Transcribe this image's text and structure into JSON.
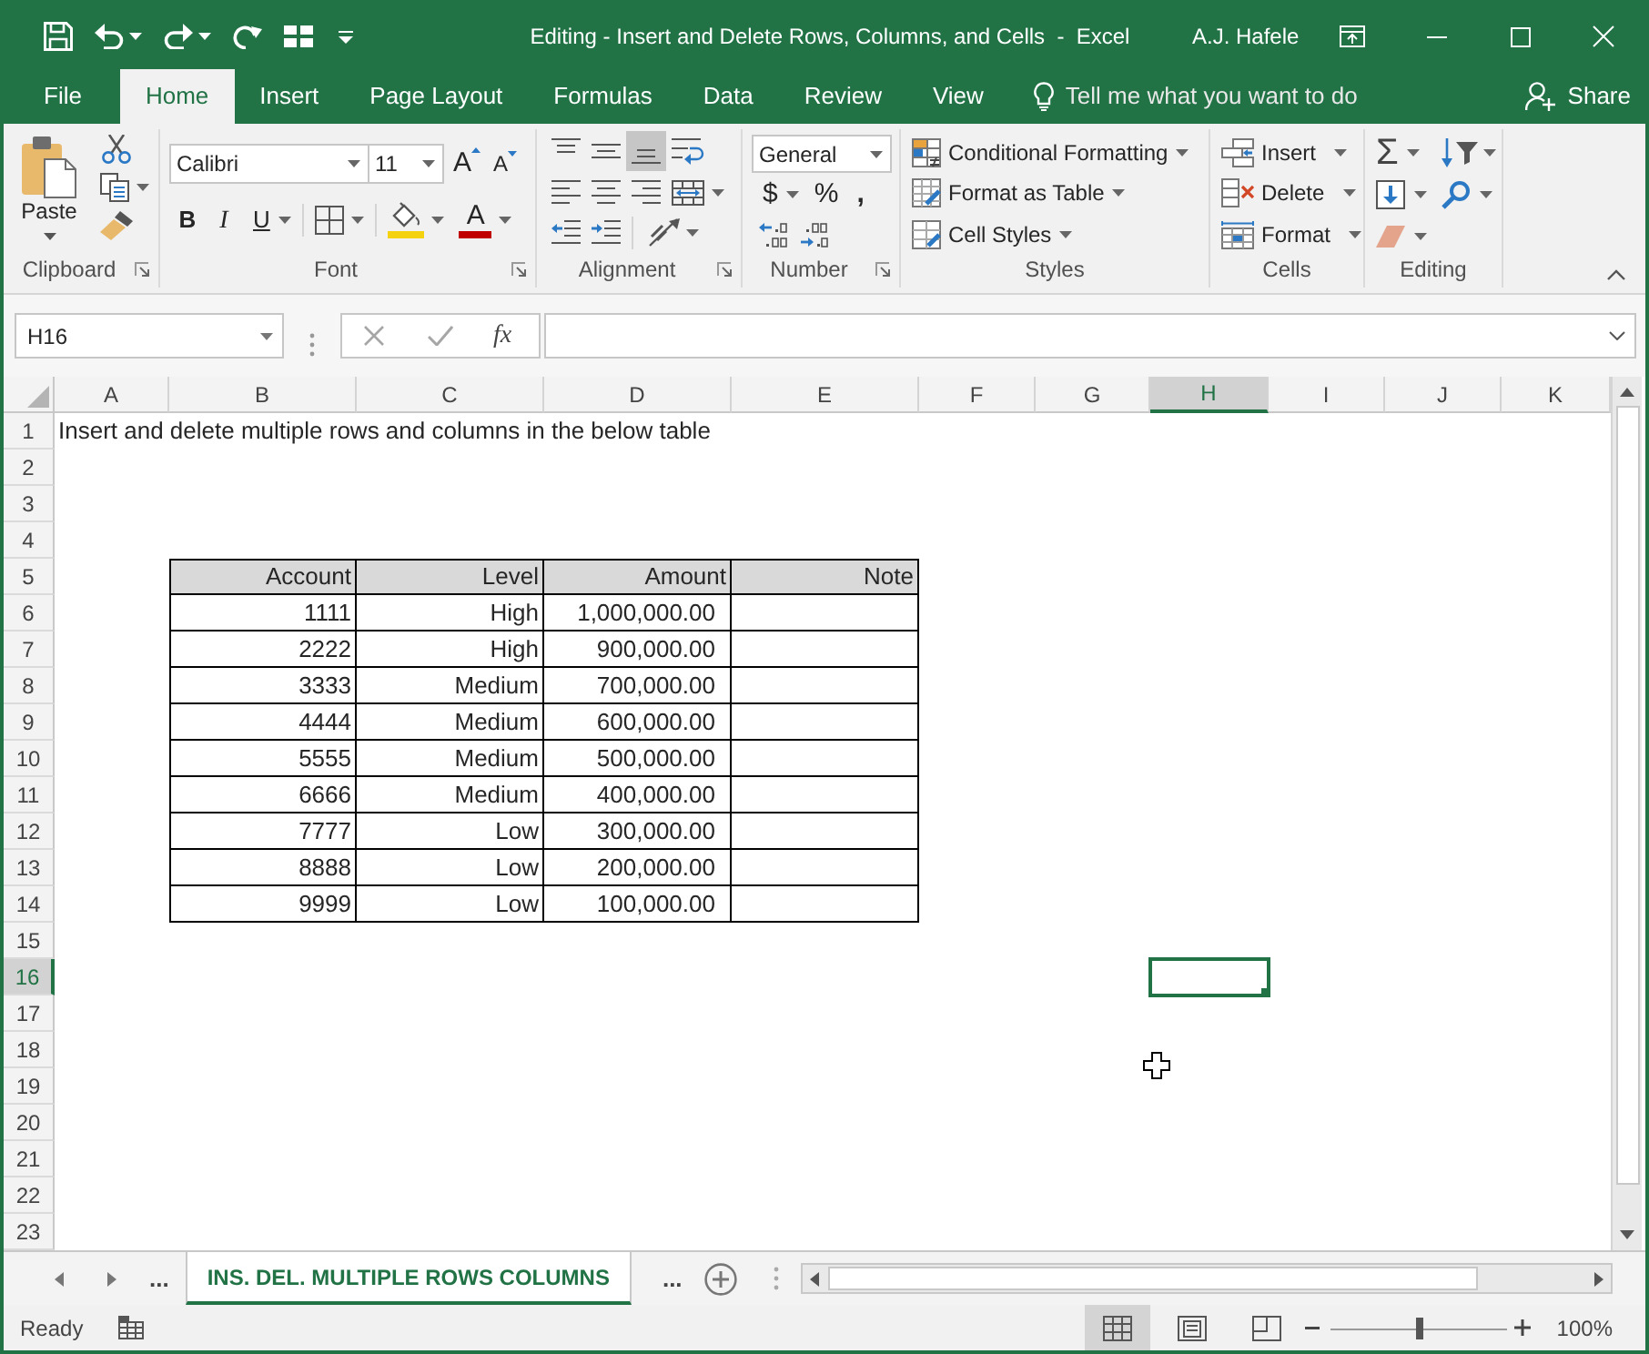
{
  "window": {
    "title": "Editing - Insert and Delete Rows, Columns, and Cells  -  Excel",
    "user": "A.J. Hafele"
  },
  "ribbon_tabs": [
    {
      "label": "File",
      "selected": false
    },
    {
      "label": "Home",
      "selected": true
    },
    {
      "label": "Insert",
      "selected": false
    },
    {
      "label": "Page Layout",
      "selected": false
    },
    {
      "label": "Formulas",
      "selected": false
    },
    {
      "label": "Data",
      "selected": false
    },
    {
      "label": "Review",
      "selected": false
    },
    {
      "label": "View",
      "selected": false
    }
  ],
  "tell_me": {
    "placeholder": "Tell me what you want to do"
  },
  "share": {
    "label": "Share"
  },
  "ribbon": {
    "clipboard": {
      "paste": "Paste",
      "label": "Clipboard"
    },
    "font": {
      "font_name": "Calibri",
      "font_size": "11",
      "grow_font": "A",
      "shrink_font": "A",
      "bold": "B",
      "italic": "I",
      "underline": "U",
      "font_color": "A",
      "label": "Font"
    },
    "alignment": {
      "vertical": [
        {
          "kind": "top",
          "selected": false
        },
        {
          "kind": "middle",
          "selected": false
        },
        {
          "kind": "bottom",
          "selected": true
        }
      ],
      "label": "Alignment"
    },
    "number": {
      "format": "General",
      "currency": "$",
      "percent": "%",
      "comma": ",",
      "label": "Number"
    },
    "styles": {
      "items": [
        {
          "kind": "conditional_formatting",
          "label": "Conditional Formatting"
        },
        {
          "kind": "format_as_table",
          "label": "Format as Table"
        },
        {
          "kind": "cell_styles",
          "label": "Cell Styles"
        }
      ],
      "label": "Styles"
    },
    "cells": {
      "items": [
        {
          "kind": "insert",
          "label": "Insert"
        },
        {
          "kind": "delete",
          "label": "Delete"
        },
        {
          "kind": "format",
          "label": "Format"
        }
      ],
      "label": "Cells"
    },
    "editing": {
      "autosum": "Σ",
      "label": "Editing"
    }
  },
  "formula_bar": {
    "name_box": "H16",
    "function_label": "fx"
  },
  "sheet": {
    "columns": [
      {
        "label": "A",
        "selected": false
      },
      {
        "label": "B",
        "selected": false
      },
      {
        "label": "C",
        "selected": false
      },
      {
        "label": "D",
        "selected": false
      },
      {
        "label": "E",
        "selected": false
      },
      {
        "label": "F",
        "selected": false
      },
      {
        "label": "G",
        "selected": false
      },
      {
        "label": "H",
        "selected": true
      },
      {
        "label": "I",
        "selected": false
      },
      {
        "label": "J",
        "selected": false
      },
      {
        "label": "K",
        "selected": false
      }
    ],
    "rows": [
      {
        "label": "1",
        "selected": false
      },
      {
        "label": "2",
        "selected": false
      },
      {
        "label": "3",
        "selected": false
      },
      {
        "label": "4",
        "selected": false
      },
      {
        "label": "5",
        "selected": false
      },
      {
        "label": "6",
        "selected": false
      },
      {
        "label": "7",
        "selected": false
      },
      {
        "label": "8",
        "selected": false
      },
      {
        "label": "9",
        "selected": false
      },
      {
        "label": "10",
        "selected": false
      },
      {
        "label": "11",
        "selected": false
      },
      {
        "label": "12",
        "selected": false
      },
      {
        "label": "13",
        "selected": false
      },
      {
        "label": "14",
        "selected": false
      },
      {
        "label": "15",
        "selected": false
      },
      {
        "label": "16",
        "selected": true
      },
      {
        "label": "17",
        "selected": false
      },
      {
        "label": "18",
        "selected": false
      },
      {
        "label": "19",
        "selected": false
      },
      {
        "label": "20",
        "selected": false
      },
      {
        "label": "21",
        "selected": false
      },
      {
        "label": "22",
        "selected": false
      },
      {
        "label": "23",
        "selected": false
      }
    ],
    "title_cell": "Insert and delete multiple rows and columns in the below table",
    "table": {
      "columns": [
        "Account",
        "Level",
        "Amount",
        "Note"
      ],
      "rows": [
        [
          "1111",
          "High",
          "1,000,000.00"
        ],
        [
          "2222",
          "High",
          "900,000.00"
        ],
        [
          "3333",
          "Medium",
          "700,000.00"
        ],
        [
          "4444",
          "Medium",
          "600,000.00"
        ],
        [
          "5555",
          "Medium",
          "500,000.00"
        ],
        [
          "6666",
          "Medium",
          "400,000.00"
        ],
        [
          "7777",
          "Low",
          "300,000.00"
        ],
        [
          "8888",
          "Low",
          "200,000.00"
        ],
        [
          "9999",
          "Low",
          "100,000.00"
        ]
      ]
    }
  },
  "sheet_tabs": {
    "more_before": "...",
    "tabs": [
      {
        "label": "INS. DEL. MULTIPLE ROWS COLUMNS",
        "selected": true
      }
    ],
    "more_after": "..."
  },
  "status_bar": {
    "status": "Ready",
    "views": [
      {
        "kind": "normal",
        "selected": true
      },
      {
        "kind": "page_layout",
        "selected": false
      },
      {
        "kind": "page_break",
        "selected": false
      }
    ],
    "zoom": {
      "level": 0.5
    },
    "zoom_label": "100%"
  }
}
